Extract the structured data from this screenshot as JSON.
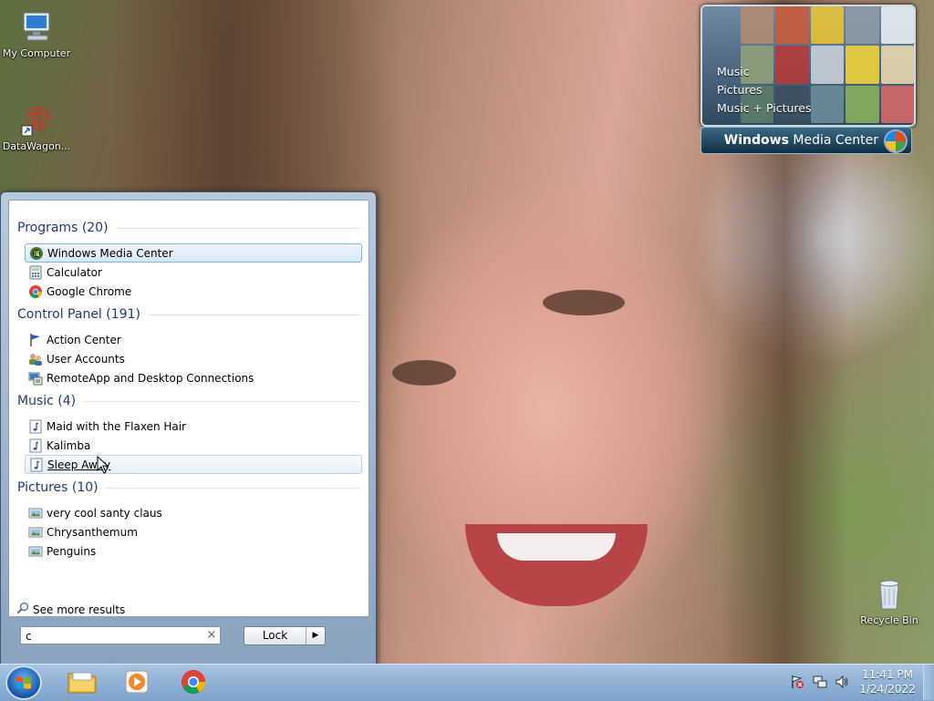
{
  "desktop": {
    "icons": [
      {
        "label": "My Computer",
        "icon": "computer-icon"
      },
      {
        "label": "DataWagon...",
        "icon": "shortcut-icon"
      },
      {
        "label": "Recycle Bin",
        "icon": "recycle-bin-icon"
      }
    ]
  },
  "gadget": {
    "menu": [
      "Music",
      "Pictures",
      "Music + Pictures"
    ],
    "bar_label_bold": "Windows",
    "bar_label_light": " Media Center"
  },
  "start_menu": {
    "groups": [
      {
        "header": "Programs (20)",
        "items": [
          {
            "label": "Windows Media Center",
            "icon": "media-center-icon",
            "state": "selected"
          },
          {
            "label": "Calculator",
            "icon": "calculator-icon"
          },
          {
            "label": "Google Chrome",
            "icon": "chrome-icon"
          }
        ]
      },
      {
        "header": "Control Panel (191)",
        "items": [
          {
            "label": "Action Center",
            "icon": "flag-icon"
          },
          {
            "label": "User Accounts",
            "icon": "users-icon"
          },
          {
            "label": "RemoteApp and Desktop Connections",
            "icon": "remote-desktop-icon"
          }
        ]
      },
      {
        "header": "Music (4)",
        "items": [
          {
            "label": "Maid with the Flaxen Hair",
            "icon": "music-file-icon"
          },
          {
            "label": "Kalimba",
            "icon": "music-file-icon"
          },
          {
            "label": "Sleep Away",
            "icon": "music-file-icon",
            "state": "hover"
          }
        ]
      },
      {
        "header": "Pictures (10)",
        "items": [
          {
            "label": "very cool santy claus",
            "icon": "image-file-icon"
          },
          {
            "label": "Chrysanthemum",
            "icon": "image-file-icon"
          },
          {
            "label": "Penguins",
            "icon": "image-file-icon"
          }
        ]
      }
    ],
    "see_more": "See more results",
    "search_value": "c",
    "clear_glyph": "×",
    "lock_label": "Lock",
    "lock_arrow": "▶"
  },
  "taskbar": {
    "pinned": [
      "explorer-icon",
      "media-player-icon",
      "chrome-icon"
    ],
    "tray": [
      "action-center-flag-icon",
      "network-icon",
      "volume-icon"
    ],
    "time": "11:41 PM",
    "date": "1/24/2022"
  }
}
